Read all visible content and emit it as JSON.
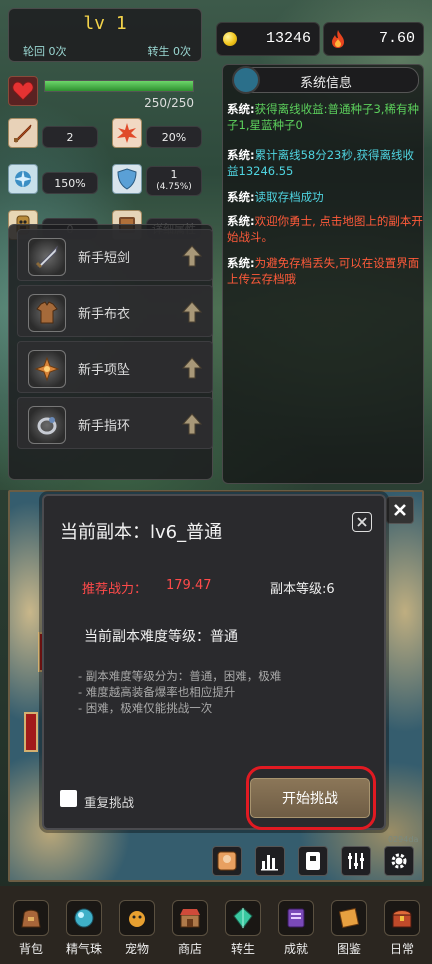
{
  "level": {
    "title": "lv 1",
    "rebirth_cycle": "轮回 0次",
    "rebirth": "转生 0次"
  },
  "currency": {
    "gold": "13246",
    "fire": "7.60"
  },
  "hp": {
    "text": "250/250",
    "ratio": 1.0
  },
  "stats": {
    "attack": "2",
    "crit_rate": "20%",
    "crit_damage": "150%",
    "defense": "1",
    "defense_pct": "(4.75%)",
    "other": "0",
    "detail_button": "详细属性"
  },
  "equipment": [
    {
      "name": "新手短剑"
    },
    {
      "name": "新手布衣"
    },
    {
      "name": "新手项坠"
    },
    {
      "name": "新手指环"
    }
  ],
  "system": {
    "title": "系统信息",
    "messages": [
      {
        "tag": "系统:",
        "text": "获得离线收益:普通种子3,稀有种子1,星蓝种子0",
        "color": "#5cd05c"
      },
      {
        "tag": "系统:",
        "text": "累计离线58分23秒,获得离线收益13246.55",
        "color": "#4fd4e0"
      },
      {
        "tag": "系统:",
        "text": "读取存档成功",
        "color": "#4fd4e0"
      },
      {
        "tag": "系统:",
        "text": "欢迎你勇士, 点击地图上的副本开始战斗。",
        "color": "#ff5a3a"
      },
      {
        "tag": "系统:",
        "text": "为避免存档丢失,可以在设置界面上传云存档哦",
        "color": "#ff5a3a"
      }
    ]
  },
  "dialog": {
    "title": "当前副本：lv6_普通",
    "recommend_label": "推荐战力：",
    "recommend_value": "179.47",
    "dungeon_level": "副本等级:6",
    "difficulty": "当前副本难度等级：普通",
    "notes": [
      "- 副本难度等级分为：普通，困难，极难",
      "- 难度越高装备爆率也相应提升",
      "- 困难，极难仅能挑战一次"
    ],
    "repeat_label": "重复挑战",
    "start_button": "开始挑战"
  },
  "map": {
    "watermark": "0294da"
  },
  "nav": [
    {
      "label": "背包",
      "icon": "bag-icon"
    },
    {
      "label": "精气珠",
      "icon": "orb-icon"
    },
    {
      "label": "宠物",
      "icon": "pet-icon"
    },
    {
      "label": "商店",
      "icon": "shop-icon"
    },
    {
      "label": "转生",
      "icon": "gem-icon"
    },
    {
      "label": "成就",
      "icon": "book-icon"
    },
    {
      "label": "图鉴",
      "icon": "scroll-icon"
    },
    {
      "label": "日常",
      "icon": "chest-icon"
    }
  ],
  "colors": {
    "hp": "#2e8f2f",
    "accent_red": "#e11a22",
    "level_gold": "#f3d34a"
  }
}
